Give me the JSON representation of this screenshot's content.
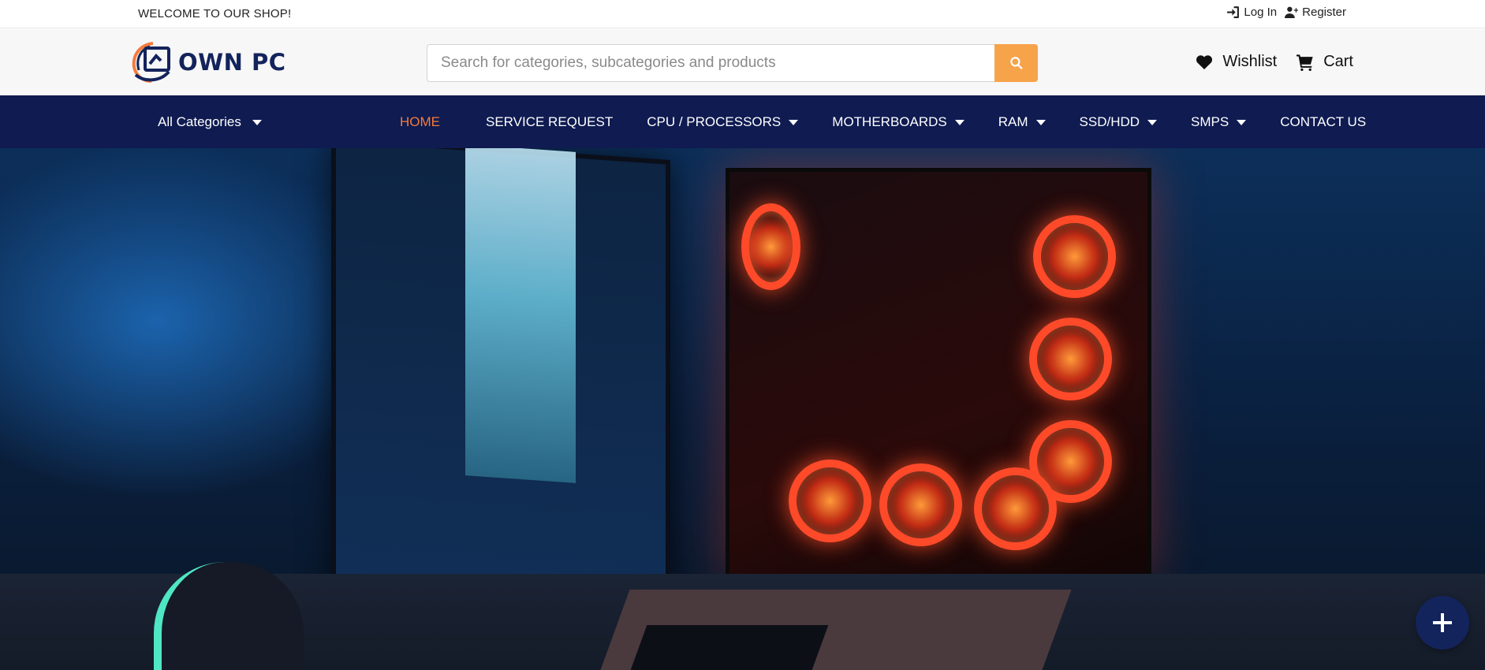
{
  "topbar": {
    "welcome": "WELCOME TO OUR SHOP!",
    "login_label": "Log In",
    "register_label": "Register"
  },
  "header": {
    "logo_text": "OWN PC",
    "search_placeholder": "Search for categories, subcategories and products",
    "wishlist_label": "Wishlist",
    "cart_label": "Cart"
  },
  "nav": {
    "all_categories": "All Categories",
    "items": [
      {
        "label": "HOME",
        "active": true,
        "dropdown": false
      },
      {
        "label": "SERVICE REQUEST",
        "active": false,
        "dropdown": false
      },
      {
        "label": "CPU / PROCESSORS",
        "active": false,
        "dropdown": true
      },
      {
        "label": "MOTHERBOARDS",
        "active": false,
        "dropdown": true
      },
      {
        "label": "RAM",
        "active": false,
        "dropdown": true
      },
      {
        "label": "SSD/HDD",
        "active": false,
        "dropdown": true
      },
      {
        "label": "SMPS",
        "active": false,
        "dropdown": true
      },
      {
        "label": "CONTACT US",
        "active": false,
        "dropdown": false
      }
    ]
  },
  "colors": {
    "navy": "#0f1b51",
    "accent_orange": "#f57b3b",
    "search_button": "#f7a34a"
  },
  "icons": {
    "login": "sign-in-icon",
    "register": "user-plus-icon",
    "search": "search-icon",
    "wishlist": "heart-icon",
    "cart": "cart-icon",
    "fab": "plus-icon"
  }
}
